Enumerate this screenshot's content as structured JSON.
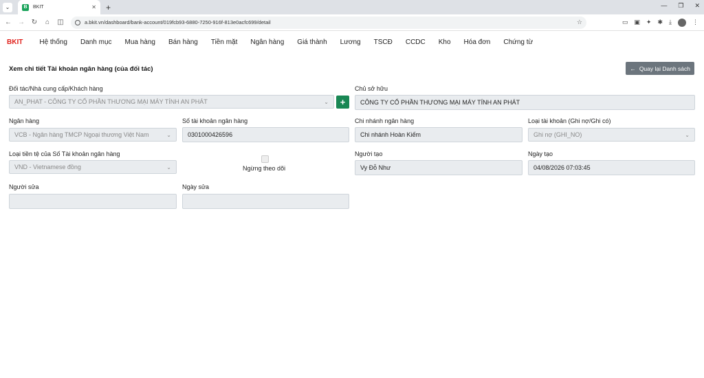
{
  "browser": {
    "tab_title": "BKIT",
    "favicon_letter": "B",
    "url": "a.bkit.vn/dashboard/bank-account/019fcb93-6880-7250-916f-813e0acfc699/detail"
  },
  "nav": {
    "brand": "BKIT",
    "items": [
      "Hệ thống",
      "Danh mục",
      "Mua hàng",
      "Bán hàng",
      "Tiền mặt",
      "Ngân hàng",
      "Giá thành",
      "Lương",
      "TSCĐ",
      "CCDC",
      "Kho",
      "Hóa đơn",
      "Chứng từ"
    ]
  },
  "page": {
    "title": "Xem chi tiết Tài khoản ngân hàng (của đối tác)",
    "back_button": "Quay lại Danh sách"
  },
  "form": {
    "partner": {
      "label": "Đối tác/Nhà cung cấp/Khách hàng",
      "value": "AN_PHAT - CÔNG TY CỔ PHẦN THƯƠNG MẠI MÁY TÍNH AN PHÁT"
    },
    "owner": {
      "label": "Chủ sở hữu",
      "value": "CÔNG TY CỔ PHẦN THƯƠNG MẠI MÁY TÍNH AN PHÁT"
    },
    "bank": {
      "label": "Ngân hàng",
      "value": "VCB - Ngân hàng TMCP Ngoại thương Việt Nam"
    },
    "account_number": {
      "label": "Số tài khoản ngân hàng",
      "value": "0301000426596"
    },
    "branch": {
      "label": "Chi nhánh ngân hàng",
      "value": "Chi nhánh Hoàn Kiếm"
    },
    "account_type": {
      "label": "Loại tài khoản (Ghi nợ/Ghi có)",
      "value": "Ghi nợ (GHI_NO)"
    },
    "currency": {
      "label": "Loại tiền tệ của Số Tài khoản ngân hàng",
      "value": "VND - Vietnamese đồng"
    },
    "stop_tracking": {
      "label": "Ngừng theo dõi",
      "checked": false
    },
    "creator": {
      "label": "Người tạo",
      "value": "Vy Đỗ Như"
    },
    "created_date": {
      "label": "Ngày tạo",
      "value": "04/08/2026 07:03:45"
    },
    "editor": {
      "label": "Người sửa",
      "value": ""
    },
    "edited_date": {
      "label": "Ngày sửa",
      "value": ""
    }
  }
}
